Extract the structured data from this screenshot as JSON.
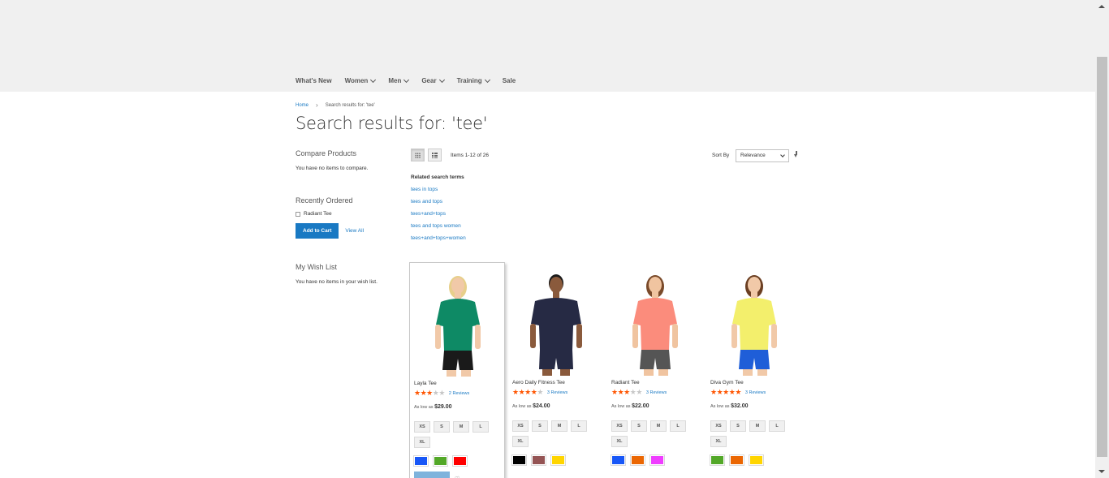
{
  "nav": {
    "items": [
      {
        "label": "What's New",
        "has_caret": false
      },
      {
        "label": "Women",
        "has_caret": true
      },
      {
        "label": "Men",
        "has_caret": true
      },
      {
        "label": "Gear",
        "has_caret": true
      },
      {
        "label": "Training",
        "has_caret": true
      },
      {
        "label": "Sale",
        "has_caret": false
      }
    ]
  },
  "breadcrumb": {
    "home": "Home",
    "separator": "›",
    "current": "Search results for: 'tee'"
  },
  "page_title": "Search results for: 'tee'",
  "sidebar": {
    "compare": {
      "title": "Compare Products",
      "empty": "You have no items to compare."
    },
    "recently_ordered": {
      "title": "Recently Ordered",
      "item": "Radiant Tee",
      "add_to_cart": "Add to Cart",
      "view_all": "View All"
    },
    "wishlist": {
      "title": "My Wish List",
      "empty": "You have no items in your wish list."
    }
  },
  "toolbar": {
    "amount": "Items 1-12 of 26",
    "sort_label": "Sort By",
    "sort_value": "Relevance",
    "mode": "grid"
  },
  "related": {
    "title": "Related search terms",
    "terms": [
      "tees in tops",
      "tees and tops",
      "tees+and+tops",
      "tees and tops women",
      "tees+and+tops+women"
    ]
  },
  "products": [
    {
      "name": "Layla Tee",
      "rating": 3,
      "reviews": "2 Reviews",
      "price_label": "As low as",
      "price": "$29.00",
      "sizes": [
        "XS",
        "S",
        "M",
        "L",
        "XL"
      ],
      "swatches": [
        "#1857f7",
        "#53a828",
        "#ff0000"
      ],
      "shirt": "#0e8a65",
      "shorts": "#1a1a1a",
      "hair": "#e7cf8a",
      "skin": "#f1c9a8"
    },
    {
      "name": "Aero Daily Fitness Tee",
      "rating": 4,
      "reviews": "3 Reviews",
      "price_label": "As low as",
      "price": "$24.00",
      "sizes": [
        "XS",
        "S",
        "M",
        "L",
        "XL"
      ],
      "swatches": [
        "#000000",
        "#945454",
        "#ffd500"
      ],
      "shirt": "#262a44",
      "shorts": "#262a44",
      "hair": "#1a1a1a",
      "skin": "#8a5a3c"
    },
    {
      "name": "Radiant Tee",
      "rating": 3,
      "reviews": "3 Reviews",
      "price_label": "As low as",
      "price": "$22.00",
      "sizes": [
        "XS",
        "S",
        "M",
        "L",
        "XL"
      ],
      "swatches": [
        "#1857f7",
        "#eb6703",
        "#ef3dff"
      ],
      "shirt": "#fb8c7c",
      "shorts": "#555555",
      "hair": "#7a4a2a",
      "skin": "#f0c4a0"
    },
    {
      "name": "Diva Gym Tee",
      "rating": 4.5,
      "reviews": "3 Reviews",
      "price_label": "As low as",
      "price": "$32.00",
      "sizes": [
        "XS",
        "S",
        "M",
        "L",
        "XL"
      ],
      "swatches": [
        "#53a828",
        "#eb6703",
        "#ffd500"
      ],
      "shirt": "#f3ef6c",
      "shorts": "#1f5ed8",
      "hair": "#6b3f22",
      "skin": "#f1c9a8"
    }
  ],
  "colors": {
    "link": "#1979c3",
    "primary_button": "#1979c3",
    "star": "#ff5501",
    "header_bg": "#f0f0f0"
  }
}
